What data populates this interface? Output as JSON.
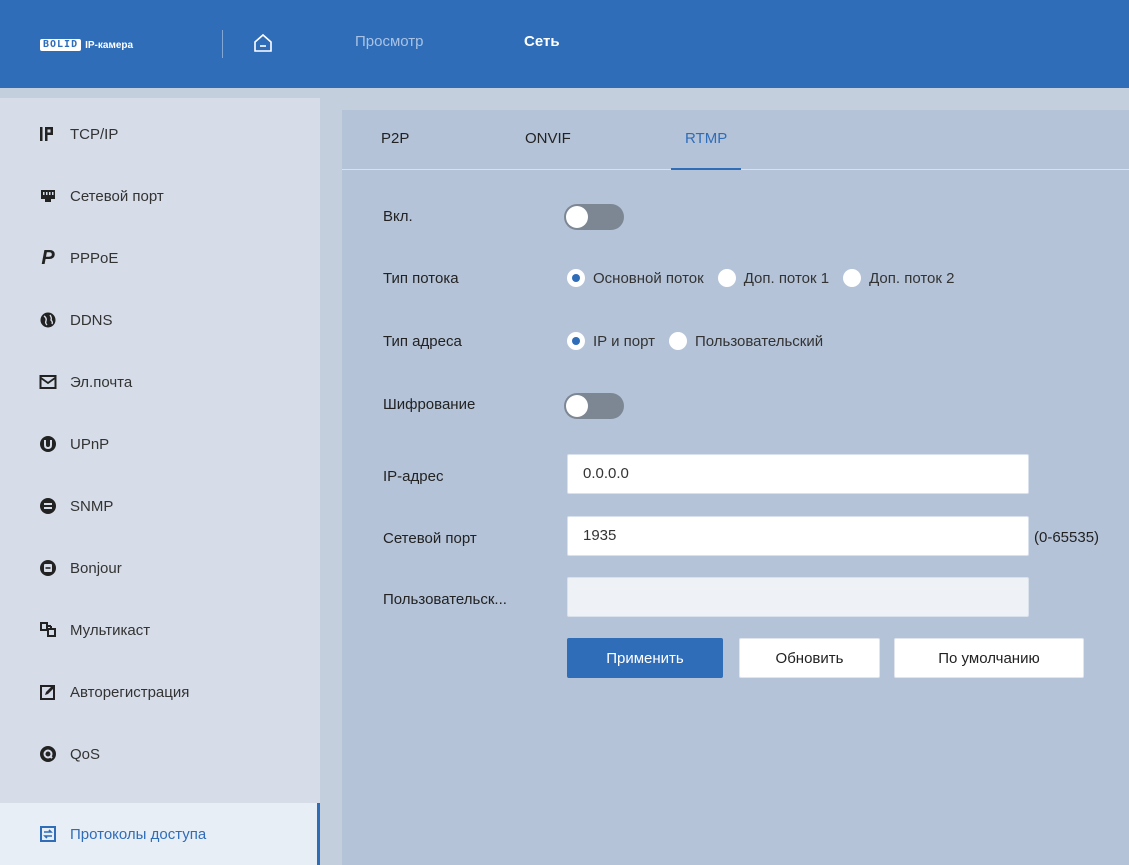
{
  "header": {
    "logo_brand": "BOLID",
    "logo_text": "IP-камера",
    "nav": [
      "Просмотр",
      "Сеть"
    ],
    "active_nav": "Сеть"
  },
  "sidebar": {
    "items": [
      {
        "label": "TCP/IP",
        "icon": "ip-icon"
      },
      {
        "label": "Сетевой порт",
        "icon": "network-port-icon"
      },
      {
        "label": "PPPoE",
        "icon": "pppoe-icon"
      },
      {
        "label": "DDNS",
        "icon": "globe-icon"
      },
      {
        "label": "Эл.почта",
        "icon": "mail-icon"
      },
      {
        "label": "UPnP",
        "icon": "upnp-icon"
      },
      {
        "label": "SNMP",
        "icon": "snmp-icon"
      },
      {
        "label": "Bonjour",
        "icon": "bonjour-icon"
      },
      {
        "label": "Мультикаст",
        "icon": "multicast-icon"
      },
      {
        "label": "Авторегистрация",
        "icon": "auto-register-icon"
      },
      {
        "label": "QoS",
        "icon": "qos-icon"
      },
      {
        "label": "Протоколы доступа",
        "icon": "access-protocols-icon"
      }
    ],
    "active": "Протоколы доступа"
  },
  "tabs": {
    "items": [
      "P2P",
      "ONVIF",
      "RTMP"
    ],
    "active": "RTMP"
  },
  "form": {
    "enable_label": "Вкл.",
    "enable_value": false,
    "stream_type_label": "Тип потока",
    "stream_types": [
      "Основной поток",
      "Доп. поток 1",
      "Доп. поток 2"
    ],
    "stream_type_selected": "Основной поток",
    "address_type_label": "Тип адреса",
    "address_types": [
      "IP и порт",
      "Пользовательский"
    ],
    "address_type_selected": "IP и порт",
    "encryption_label": "Шифрование",
    "encryption_value": false,
    "ip_label": "IP-адрес",
    "ip_value": "0.0.0.0",
    "port_label": "Сетевой порт",
    "port_value": "1935",
    "port_hint": "(0-65535)",
    "custom_label": "Пользовательск...",
    "custom_value": ""
  },
  "buttons": {
    "apply": "Применить",
    "refresh": "Обновить",
    "default": "По умолчанию"
  },
  "colors": {
    "accent": "#2f6db8",
    "header_bg": "#2f6db8",
    "content_bg": "#b4c3d8"
  }
}
